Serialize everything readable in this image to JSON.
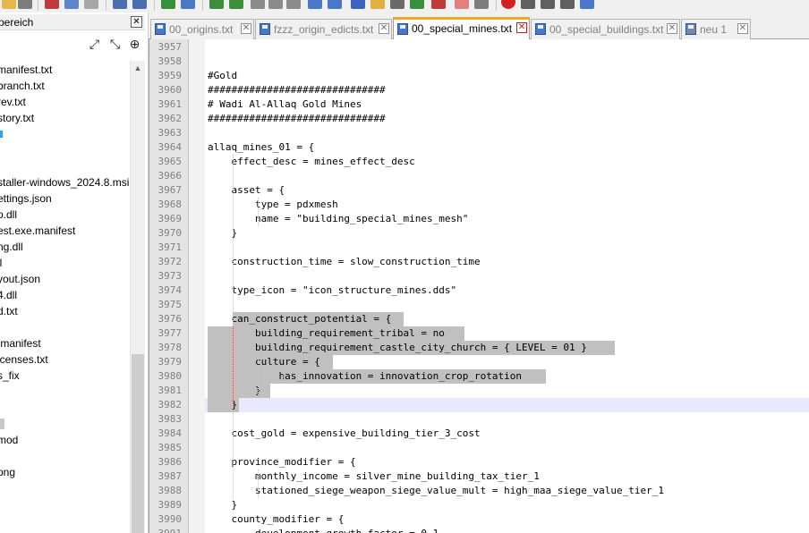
{
  "left_panel": {
    "title": "pereich",
    "close_label": "✕",
    "files": [
      {
        "name": "manifest.txt",
        "marker": false
      },
      {
        "name": "branch.txt",
        "marker": false
      },
      {
        "name": "rev.txt",
        "marker": false
      },
      {
        "name": "story.txt",
        "marker": false
      },
      {
        "name": "",
        "marker": true
      },
      {
        "name": "",
        "marker": false
      },
      {
        "name": "",
        "marker": false
      },
      {
        "name": "staller-windows_2024.8.msi",
        "marker": false
      },
      {
        "name": "ettings.json",
        "marker": false
      },
      {
        "name": "p.dll",
        "marker": false
      },
      {
        "name": "est.exe.manifest",
        "marker": false
      },
      {
        "name": "ng.dll",
        "marker": false
      },
      {
        "name": "ll",
        "marker": false
      },
      {
        "name": "yout.json",
        "marker": false
      },
      {
        "name": "4.dll",
        "marker": false
      },
      {
        "name": "d.txt",
        "marker": false
      },
      {
        "name": ":",
        "marker": false
      },
      {
        "name": ".manifest",
        "marker": false
      },
      {
        "name": "icenses.txt",
        "marker": false
      },
      {
        "name": "s_fix",
        "marker": false
      },
      {
        "name": "",
        "marker": false
      },
      {
        "name": "",
        "marker": false
      },
      {
        "name": "",
        "marker": "grey"
      },
      {
        "name": "mod",
        "marker": false
      },
      {
        "name": "",
        "marker": false
      },
      {
        "name": "png",
        "marker": false
      }
    ]
  },
  "tabs": [
    {
      "label": "00_origins.txt",
      "active": false,
      "modified": false
    },
    {
      "label": "fzzz_origin_edicts.txt",
      "active": false,
      "modified": false
    },
    {
      "label": "00_special_mines.txt",
      "active": true,
      "modified": false
    },
    {
      "label": "00_special_buildings.txt",
      "active": false,
      "modified": false
    },
    {
      "label": "neu 1",
      "active": false,
      "modified": true
    }
  ],
  "tab_close_label": "✕",
  "editor": {
    "lines": [
      {
        "n": "3957",
        "text": ""
      },
      {
        "n": "3958",
        "text": ""
      },
      {
        "n": "3959",
        "text": "#Gold"
      },
      {
        "n": "3960",
        "text": "##############################"
      },
      {
        "n": "3961",
        "text": "# Wadi Al-Allaq Gold Mines"
      },
      {
        "n": "3962",
        "text": "##############################"
      },
      {
        "n": "3963",
        "text": ""
      },
      {
        "n": "3964",
        "text": "allaq_mines_01 = {"
      },
      {
        "n": "3965",
        "text": "    effect_desc = mines_effect_desc"
      },
      {
        "n": "3966",
        "text": ""
      },
      {
        "n": "3967",
        "text": "    asset = {"
      },
      {
        "n": "3968",
        "text": "        type = pdxmesh"
      },
      {
        "n": "3969",
        "text": "        name = \"building_special_mines_mesh\""
      },
      {
        "n": "3970",
        "text": "    }"
      },
      {
        "n": "3971",
        "text": ""
      },
      {
        "n": "3972",
        "text": "    construction_time = slow_construction_time"
      },
      {
        "n": "3973",
        "text": ""
      },
      {
        "n": "3974",
        "text": "    type_icon = \"icon_structure_mines.dds\""
      },
      {
        "n": "3975",
        "text": ""
      },
      {
        "n": "3976",
        "text": "    can_construct_potential = {"
      },
      {
        "n": "3977",
        "text": "        building_requirement_tribal = no"
      },
      {
        "n": "3978",
        "text": "        building_requirement_castle_city_church = { LEVEL = 01 }"
      },
      {
        "n": "3979",
        "text": "        culture = {"
      },
      {
        "n": "3980",
        "text": "            has_innovation = innovation_crop_rotation"
      },
      {
        "n": "3981",
        "text": "        }"
      },
      {
        "n": "3982",
        "text": "    }"
      },
      {
        "n": "3983",
        "text": ""
      },
      {
        "n": "3984",
        "text": "    cost_gold = expensive_building_tier_3_cost"
      },
      {
        "n": "3985",
        "text": ""
      },
      {
        "n": "3986",
        "text": "    province_modifier = {"
      },
      {
        "n": "3987",
        "text": "        monthly_income = silver_mine_building_tax_tier_1"
      },
      {
        "n": "3988",
        "text": "        stationed_siege_weapon_siege_value_mult = high_maa_siege_value_tier_1"
      },
      {
        "n": "3989",
        "text": "    }"
      },
      {
        "n": "3990",
        "text": "    county_modifier = {"
      },
      {
        "n": "3991",
        "text": "        development_growth_factor = 0.1"
      }
    ]
  },
  "colors": {
    "selection": "#c0c0c0",
    "current_line": "#e8e8ff",
    "brace_match": "#e04040",
    "active_tab_accent": "#f5a623",
    "folder_marker": "#3a9de0"
  }
}
